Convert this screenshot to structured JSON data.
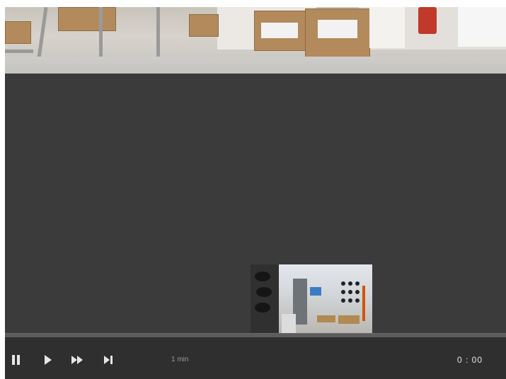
{
  "player": {
    "speed_label": "1 min",
    "time_display": "0 : 00"
  },
  "icons": {
    "pause": "pause-icon",
    "play": "play-icon",
    "fast_forward": "fast-forward-icon",
    "step_forward": "skip-next-icon"
  },
  "colors": {
    "player_background": "#3b3b3b",
    "control_bar": "#2f2f2f",
    "timeline": "#5c5c5c",
    "icon": "#e6e6e6"
  }
}
